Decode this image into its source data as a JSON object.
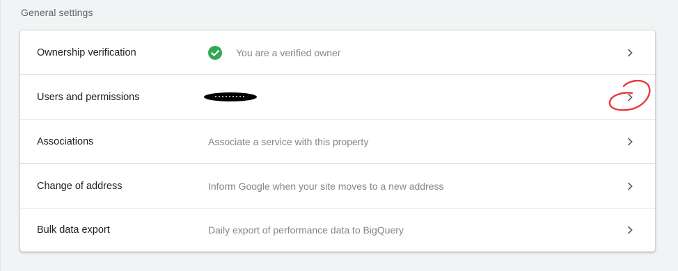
{
  "section": {
    "heading": "General settings"
  },
  "rows": [
    {
      "title": "Ownership verification",
      "description": "You are a verified owner",
      "icon": "check-circle-icon"
    },
    {
      "title": "Users and permissions",
      "description": ""
    },
    {
      "title": "Associations",
      "description": "Associate a service with this property"
    },
    {
      "title": "Change of address",
      "description": "Inform Google when your site moves to a new address"
    },
    {
      "title": "Bulk data export",
      "description": "Daily export of performance data to BigQuery"
    }
  ],
  "colors": {
    "verified_green": "#34a853",
    "annotation_red": "#e53935"
  }
}
